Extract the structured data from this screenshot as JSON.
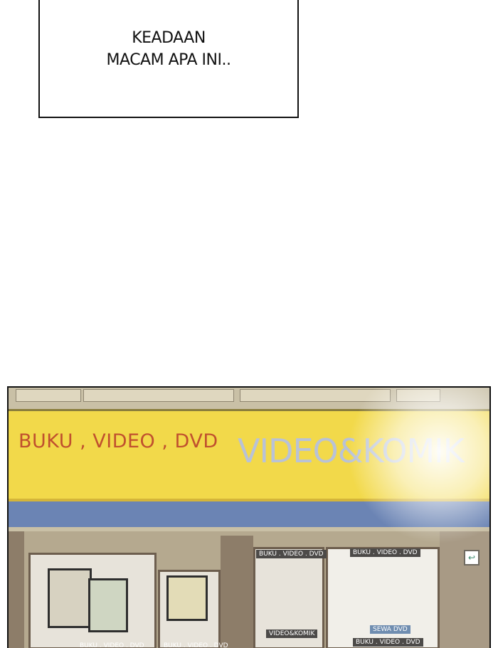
{
  "caption": {
    "line1": "KEADAAN",
    "line2": "MACAM APA INI.."
  },
  "storefront": {
    "sign_left": "BUKU , VIDEO , DVD",
    "sign_right": "VIDEO&KOMIK",
    "door_label_1": "BUKU . VIDEO . DVD",
    "door_label_2": "BUKU . VIDEO . DVD",
    "door_label_3": "VIDEO&KOMIK",
    "door_label_4": "SEWA DVD",
    "door_label_5": "BUKU . VIDEO . DVD",
    "bottom_label_1": "BUKU . VIDEO . DVD",
    "bottom_label_2": "BUKU . VIDEO . DVD"
  },
  "colors": {
    "sign_yellow": "#f2d94a",
    "sign_blue": "#6b84b4",
    "sign_text_red": "#c0502e",
    "sign_text_pale": "#b9c2d6"
  }
}
